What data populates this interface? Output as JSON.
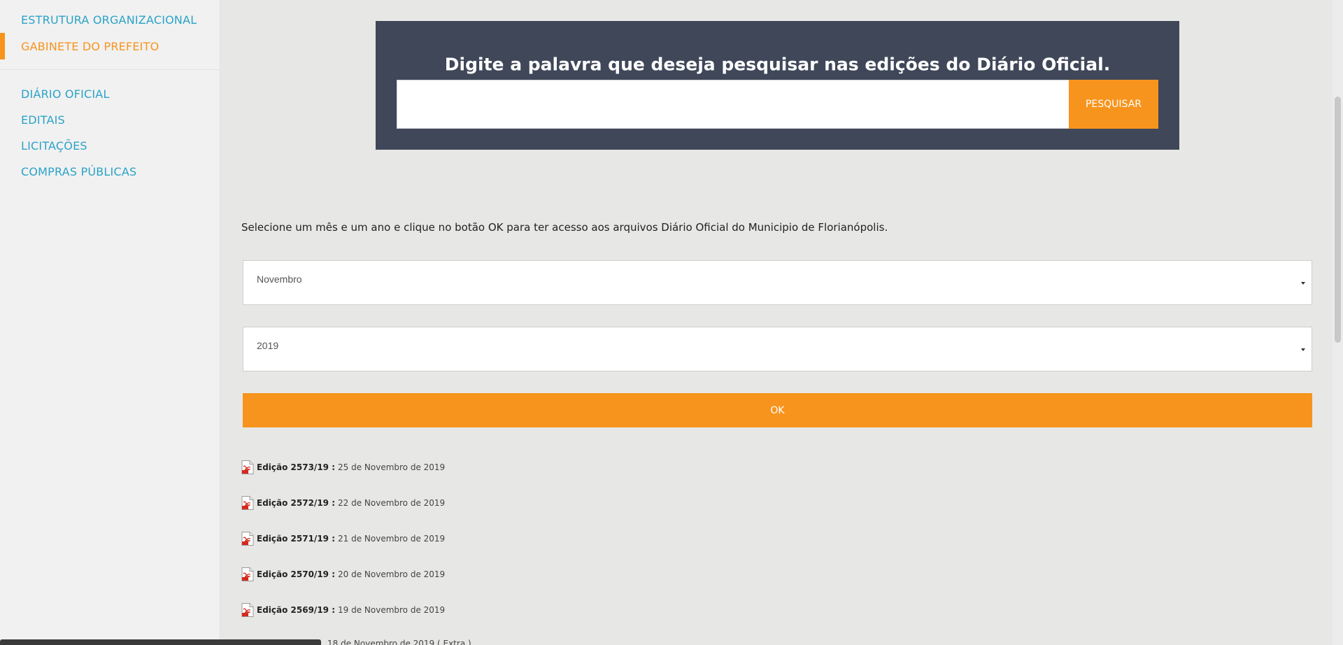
{
  "sidebar": {
    "items": [
      {
        "label": "ESTRUTURA ORGANIZACIONAL",
        "active": false
      },
      {
        "label": "GABINETE DO PREFEITO",
        "active": true
      },
      {
        "label": "DIÁRIO OFICIAL",
        "active": false
      },
      {
        "label": "EDITAIS",
        "active": false
      },
      {
        "label": "LICITAÇÕES",
        "active": false
      },
      {
        "label": "COMPRAS PÚBLICAS",
        "active": false
      }
    ]
  },
  "search": {
    "title": "Digite a palavra que deseja pesquisar nas edições do Diário Oficial.",
    "input_value": "",
    "button_label": "PESQUISAR"
  },
  "instruction": "Selecione um mês e um ano e clique no botão OK para ter acesso aos arquivos Diário Oficial do Municipio de Florianópolis.",
  "filters": {
    "month": "Novembro",
    "year": "2019",
    "ok_label": "OK"
  },
  "editions": [
    {
      "label": "Edição 2573/19 :",
      "date": "25 de Novembro de 2019"
    },
    {
      "label": "Edição 2572/19 :",
      "date": "22 de Novembro de 2019"
    },
    {
      "label": "Edição 2571/19 :",
      "date": "21 de Novembro de 2019"
    },
    {
      "label": "Edição 2570/19 :",
      "date": "20 de Novembro de 2019"
    },
    {
      "label": "Edição 2569/19 :",
      "date": "19 de Novembro de 2019"
    }
  ],
  "partial_edition_date": "18 de Novembro de 2019 ( Extra )",
  "colors": {
    "accent": "#f7941d",
    "link": "#2aa3c7",
    "banner": "#3f4759"
  },
  "icons": [
    "pdf-icon",
    "chevron-down-icon"
  ]
}
